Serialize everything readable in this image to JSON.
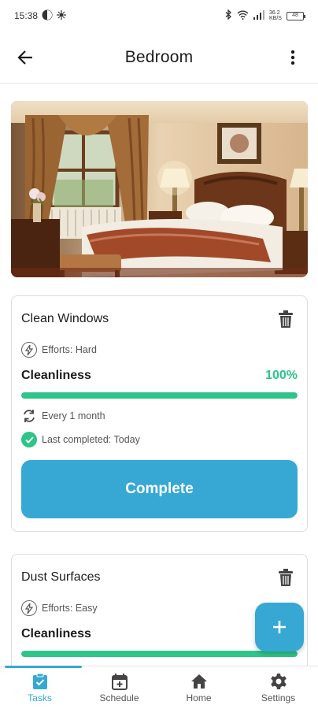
{
  "status_bar": {
    "time": "15:38",
    "network_speed": "36.2 KB/S",
    "battery": "48"
  },
  "header": {
    "title": "Bedroom",
    "back_icon": "arrow-left-icon",
    "menu_icon": "more-vertical-icon"
  },
  "hero_image": {
    "subject": "bedroom-photo"
  },
  "tasks": [
    {
      "title": "Clean Windows",
      "effort": "Efforts: Hard",
      "metric_label": "Cleanliness",
      "metric_value": "100%",
      "progress": 1.0,
      "frequency": "Every 1 month",
      "last_completed": "Last completed: Today",
      "action_label": "Complete"
    },
    {
      "title": "Dust Surfaces",
      "effort": "Efforts: Easy",
      "metric_label": "Cleanliness",
      "progress": 1.0
    }
  ],
  "fab": {
    "icon": "plus-icon"
  },
  "bottom_nav": {
    "items": [
      {
        "label": "Tasks",
        "icon": "tasks-icon",
        "active": true
      },
      {
        "label": "Schedule",
        "icon": "calendar-icon",
        "active": false
      },
      {
        "label": "Home",
        "icon": "home-icon",
        "active": false
      },
      {
        "label": "Settings",
        "icon": "gear-icon",
        "active": false
      }
    ]
  },
  "colors": {
    "accent": "#36a8d3",
    "success": "#2ec48a"
  }
}
